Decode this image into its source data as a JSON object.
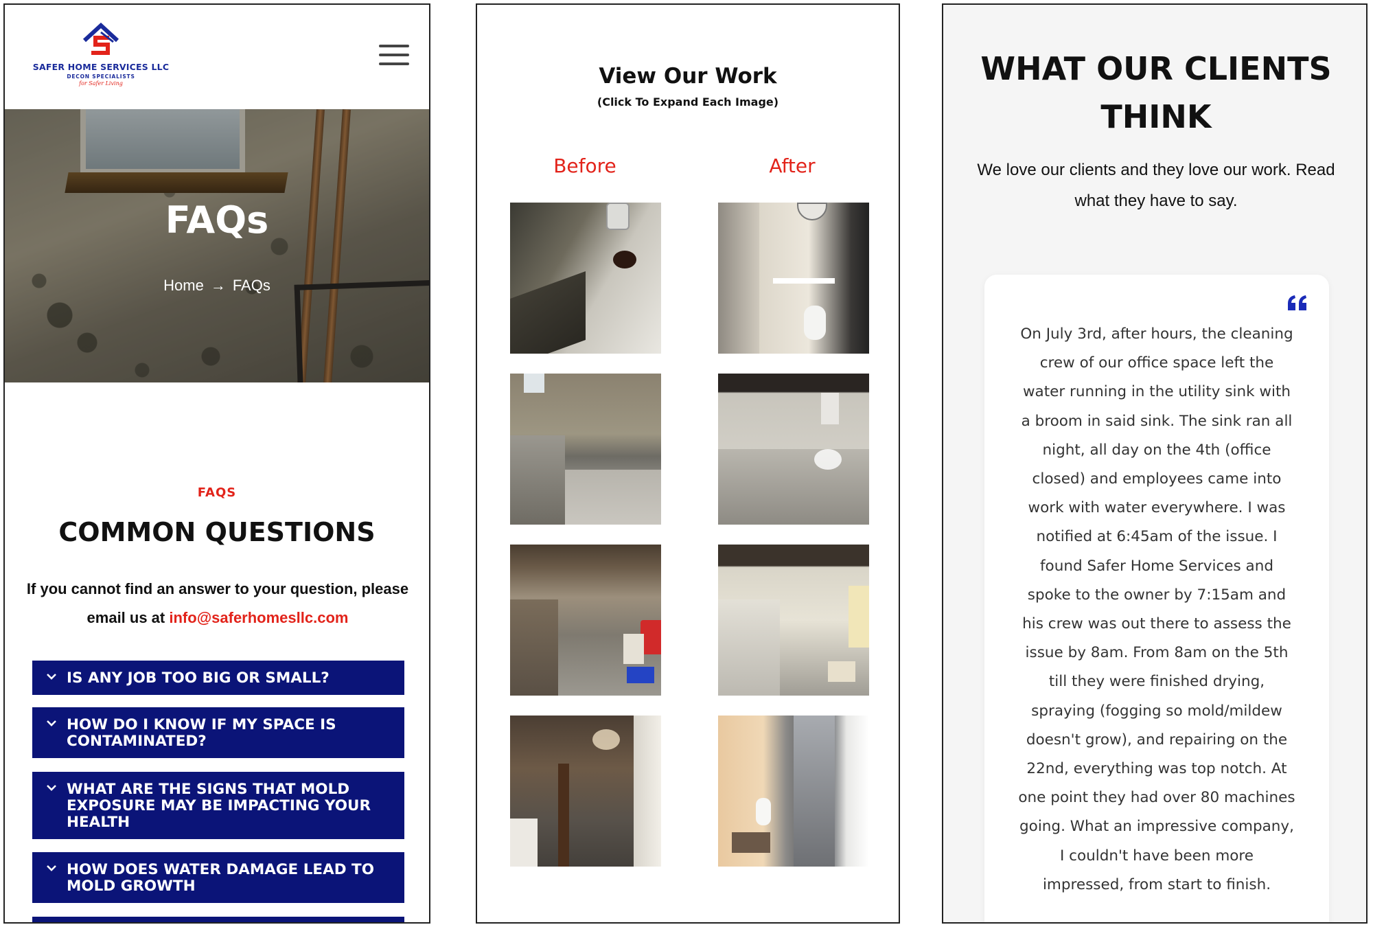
{
  "faq_page": {
    "logo": {
      "name": "SAFER HOME SERVICES LLC",
      "subtitle": "DECON SPECIALISTS",
      "tagline": "for Safer Living"
    },
    "menu_icon": "hamburger-icon",
    "hero": {
      "title": "FAQs",
      "breadcrumb": {
        "home": "Home",
        "separator": "→",
        "current": "FAQs"
      }
    },
    "section": {
      "eyebrow": "FAQS",
      "heading": "COMMON QUESTIONS",
      "intro": "If you cannot find an answer to your question, please email us at",
      "email": "info@saferhomesllc.com"
    },
    "faqs": [
      {
        "question": "IS ANY JOB TOO BIG OR SMALL?"
      },
      {
        "question": "HOW DO I KNOW IF MY SPACE IS CONTAMINATED?"
      },
      {
        "question": "WHAT ARE THE SIGNS THAT MOLD EXPOSURE MAY BE IMPACTING YOUR HEALTH"
      },
      {
        "question": "HOW DOES WATER DAMAGE LEAD TO MOLD GROWTH"
      }
    ]
  },
  "work_page": {
    "title": "View Our Work",
    "subtitle": "(Click To Expand Each Image)",
    "before_label": "Before",
    "after_label": "After"
  },
  "reviews_page": {
    "heading": "WHAT OUR CLIENTS THINK",
    "subheading": "We love our clients and they love our work. Read what they have to say.",
    "quote_icon": "quote-icon",
    "review": "On July 3rd, after hours, the cleaning crew of our office space left the water running in the utility sink with a broom in said sink. The sink ran all night, all day on the 4th (office closed) and employees came into work with water everywhere. I was notified at 6:45am of the issue. I found Safer Home Services and spoke to the owner by 7:15am and his crew was out there to assess the issue by 8am. From 8am on the 5th till they were finished drying, spraying (fogging so mold/mildew doesn't grow), and repairing on the 22nd, everything was top notch. At one point they had over 80 machines going. What an impressive company, I couldn't have been more impressed, from start to finish."
  },
  "colors": {
    "brand_navy": "#0b1478",
    "accent_red": "#e2231a",
    "quote_blue": "#1a2bb8"
  }
}
